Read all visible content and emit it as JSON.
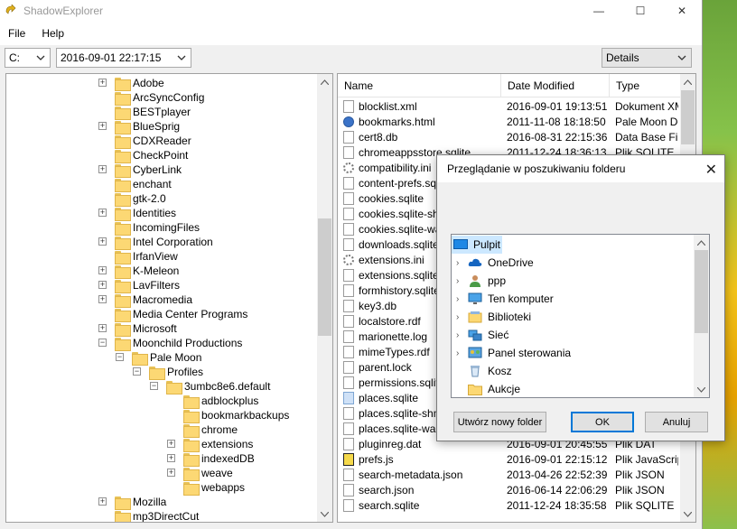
{
  "app": {
    "title": "ShadowExplorer"
  },
  "window_controls": {
    "minimize": "—",
    "maximize": "☐",
    "close": "✕"
  },
  "menu": [
    "File",
    "Help"
  ],
  "toolbar": {
    "drive": "C:",
    "snapshot": "2016-09-01 22:17:15",
    "view": "Details"
  },
  "tree": [
    {
      "label": "Adobe",
      "depth": 3,
      "expander": "plus"
    },
    {
      "label": "ArcSyncConfig",
      "depth": 3,
      "expander": ""
    },
    {
      "label": "BESTplayer",
      "depth": 3,
      "expander": ""
    },
    {
      "label": "BlueSprig",
      "depth": 3,
      "expander": "plus"
    },
    {
      "label": "CDXReader",
      "depth": 3,
      "expander": ""
    },
    {
      "label": "CheckPoint",
      "depth": 3,
      "expander": ""
    },
    {
      "label": "CyberLink",
      "depth": 3,
      "expander": "plus"
    },
    {
      "label": "enchant",
      "depth": 3,
      "expander": ""
    },
    {
      "label": "gtk-2.0",
      "depth": 3,
      "expander": ""
    },
    {
      "label": "Identities",
      "depth": 3,
      "expander": "plus"
    },
    {
      "label": "IncomingFiles",
      "depth": 3,
      "expander": ""
    },
    {
      "label": "Intel Corporation",
      "depth": 3,
      "expander": "plus"
    },
    {
      "label": "IrfanView",
      "depth": 3,
      "expander": ""
    },
    {
      "label": "K-Meleon",
      "depth": 3,
      "expander": "plus"
    },
    {
      "label": "LavFilters",
      "depth": 3,
      "expander": "plus"
    },
    {
      "label": "Macromedia",
      "depth": 3,
      "expander": "plus"
    },
    {
      "label": "Media Center Programs",
      "depth": 3,
      "expander": ""
    },
    {
      "label": "Microsoft",
      "depth": 3,
      "expander": "plus"
    },
    {
      "label": "Moonchild Productions",
      "depth": 3,
      "expander": "minus"
    },
    {
      "label": "Pale Moon",
      "depth": 4,
      "expander": "minus"
    },
    {
      "label": "Profiles",
      "depth": 5,
      "expander": "minus"
    },
    {
      "label": "3umbc8e6.default",
      "depth": 6,
      "expander": "minus"
    },
    {
      "label": "adblockplus",
      "depth": 7,
      "expander": ""
    },
    {
      "label": "bookmarkbackups",
      "depth": 7,
      "expander": ""
    },
    {
      "label": "chrome",
      "depth": 7,
      "expander": ""
    },
    {
      "label": "extensions",
      "depth": 7,
      "expander": "plus"
    },
    {
      "label": "indexedDB",
      "depth": 7,
      "expander": "plus"
    },
    {
      "label": "weave",
      "depth": 7,
      "expander": "plus"
    },
    {
      "label": "webapps",
      "depth": 7,
      "expander": ""
    },
    {
      "label": "Mozilla",
      "depth": 3,
      "expander": "plus"
    },
    {
      "label": "mp3DirectCut",
      "depth": 3,
      "expander": ""
    }
  ],
  "list": {
    "columns": [
      "Name",
      "Date Modified",
      "Type"
    ],
    "rows": [
      {
        "name": "blocklist.xml",
        "date": "2016-09-01 19:13:51",
        "type": "Dokument XM",
        "icon": "file"
      },
      {
        "name": "bookmarks.html",
        "date": "2011-11-08 18:18:50",
        "type": "Pale Moon Do",
        "icon": "globe"
      },
      {
        "name": "cert8.db",
        "date": "2016-08-31 22:15:36",
        "type": "Data Base File",
        "icon": "file"
      },
      {
        "name": "chromeappsstore.sqlite",
        "date": "2011-12-24 18:36:13",
        "type": "Plik SQLITE",
        "icon": "file"
      },
      {
        "name": "compatibility.ini",
        "date": "",
        "type": "",
        "icon": "gear"
      },
      {
        "name": "content-prefs.sqlite",
        "date": "",
        "type": "",
        "icon": "file"
      },
      {
        "name": "cookies.sqlite",
        "date": "",
        "type": "",
        "icon": "file"
      },
      {
        "name": "cookies.sqlite-shm",
        "date": "",
        "type": "",
        "icon": "file"
      },
      {
        "name": "cookies.sqlite-wal",
        "date": "",
        "type": "",
        "icon": "file"
      },
      {
        "name": "downloads.sqlite",
        "date": "",
        "type": "",
        "icon": "file"
      },
      {
        "name": "extensions.ini",
        "date": "",
        "type": "",
        "icon": "gear"
      },
      {
        "name": "extensions.sqlite",
        "date": "",
        "type": "",
        "icon": "file"
      },
      {
        "name": "formhistory.sqlite",
        "date": "",
        "type": "",
        "icon": "file"
      },
      {
        "name": "key3.db",
        "date": "",
        "type": "",
        "icon": "file"
      },
      {
        "name": "localstore.rdf",
        "date": "",
        "type": "",
        "icon": "file"
      },
      {
        "name": "marionette.log",
        "date": "",
        "type": "",
        "icon": "file"
      },
      {
        "name": "mimeTypes.rdf",
        "date": "",
        "type": "",
        "icon": "file"
      },
      {
        "name": "parent.lock",
        "date": "",
        "type": "",
        "icon": "file"
      },
      {
        "name": "permissions.sqlite",
        "date": "",
        "type": "",
        "icon": "file"
      },
      {
        "name": "places.sqlite",
        "date": "",
        "type": "",
        "icon": "sel"
      },
      {
        "name": "places.sqlite-shm",
        "date": "",
        "type": "",
        "icon": "file"
      },
      {
        "name": "places.sqlite-wal",
        "date": "",
        "type": "",
        "icon": "file"
      },
      {
        "name": "pluginreg.dat",
        "date": "2016-09-01 20:45:55",
        "type": "Plik DAT",
        "icon": "file"
      },
      {
        "name": "prefs.js",
        "date": "2016-09-01 22:15:12",
        "type": "Plik JavaScrip",
        "icon": "js"
      },
      {
        "name": "search-metadata.json",
        "date": "2013-04-26 22:52:39",
        "type": "Plik JSON",
        "icon": "file"
      },
      {
        "name": "search.json",
        "date": "2016-06-14 22:06:29",
        "type": "Plik JSON",
        "icon": "file"
      },
      {
        "name": "search.sqlite",
        "date": "2011-12-24 18:35:58",
        "type": "Plik SQLITE",
        "icon": "file"
      }
    ]
  },
  "dialog": {
    "title": "Przeglądanie w poszukiwaniu folderu",
    "close": "✕",
    "items": [
      {
        "label": "Pulpit",
        "icon": "desktop",
        "chevron": "",
        "selected": true,
        "indent": 0
      },
      {
        "label": "OneDrive",
        "icon": "cloud",
        "chevron": "›",
        "selected": false,
        "indent": 1
      },
      {
        "label": "ppp",
        "icon": "user",
        "chevron": "›",
        "selected": false,
        "indent": 1
      },
      {
        "label": "Ten komputer",
        "icon": "computer",
        "chevron": "›",
        "selected": false,
        "indent": 1
      },
      {
        "label": "Biblioteki",
        "icon": "library",
        "chevron": "›",
        "selected": false,
        "indent": 1
      },
      {
        "label": "Sieć",
        "icon": "network",
        "chevron": "›",
        "selected": false,
        "indent": 1
      },
      {
        "label": "Panel sterowania",
        "icon": "control-panel",
        "chevron": "›",
        "selected": false,
        "indent": 1
      },
      {
        "label": "Kosz",
        "icon": "recycle-bin",
        "chevron": "",
        "selected": false,
        "indent": 1
      },
      {
        "label": "Aukcje",
        "icon": "folder",
        "chevron": "",
        "selected": false,
        "indent": 1
      }
    ],
    "buttons": {
      "new_folder": "Utwórz nowy folder",
      "ok": "OK",
      "cancel": "Anuluj"
    }
  }
}
